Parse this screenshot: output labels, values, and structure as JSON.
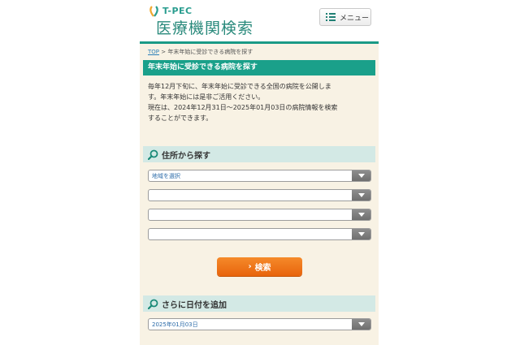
{
  "header": {
    "logo_small": "T-PEC",
    "logo_big": "医療機関検索",
    "menu_label": "メニュー"
  },
  "breadcrumb": {
    "home": "TOP",
    "separator": ">",
    "current": "年末年始に受診できる病院を探す"
  },
  "page_title": "年末年始に受診できる病院を探す",
  "intro": {
    "line1": "毎年12月下旬に、年末年始に受診できる全国の病院を公開しま",
    "line2": "す。年末年始には是非ご活用ください。",
    "line3": "現在は、2024年12月31日〜2025年01月03日の病院情報を検索",
    "line4": "することができます。"
  },
  "address_section": {
    "title": "住所から探す",
    "selects": [
      {
        "value": "地域を選択"
      },
      {
        "value": ""
      },
      {
        "value": ""
      },
      {
        "value": ""
      }
    ]
  },
  "search_button": {
    "chevron": "›",
    "label": "検索"
  },
  "date_section": {
    "title": "さらに日付を追加",
    "select_value": "2025年01月03日"
  },
  "colors": {
    "brand_green": "#1aa08a",
    "section_bg": "#d3e9e5",
    "content_bg": "#f8f2e4",
    "button_orange": "#ef7a1c",
    "link_blue": "#2a7fb8"
  }
}
